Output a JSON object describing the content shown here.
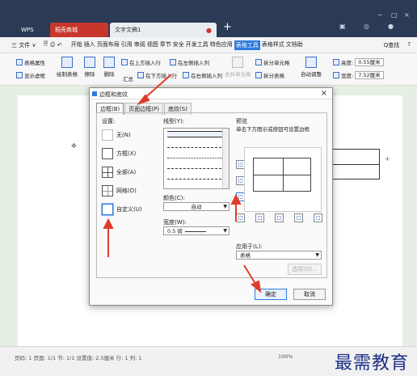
{
  "titlebar": {
    "tabs": [
      {
        "label": "WPS"
      },
      {
        "label": "稻壳商城"
      },
      {
        "label": "文字文稿1"
      }
    ],
    "new_tab": "+"
  },
  "menubar": {
    "file": "三 文件 ∨",
    "items": [
      "开始",
      "插入",
      "页面布局",
      "引用",
      "审阅",
      "视图",
      "章节",
      "安全",
      "开发工具",
      "特色应用",
      "表格工具",
      "表格样式",
      "文档助"
    ],
    "active": "表格工具",
    "search": "Q查找",
    "help": "?"
  },
  "toolbar": {
    "table_props": "表格属性",
    "show_gridlines": "显示虚框",
    "draw_table": "绘制表格",
    "erase": "擦除",
    "delete": "删除",
    "summary": "汇总",
    "insert_above": "在上方插入行",
    "insert_left": "在左侧插入列",
    "insert_below": "在下方插入行",
    "insert_right": "在右侧插入列",
    "merge_cells": "合并单元格",
    "split_cells": "拆分单元格",
    "split_table": "拆分表格",
    "autofit": "自动调整",
    "height_label": "高度:",
    "height_value": "0.55厘米",
    "width_label": "宽度:",
    "width_value": "7.52厘米"
  },
  "dialog": {
    "title": "边框和底纹",
    "close": "×",
    "tabs": [
      "边框(B)",
      "页面边框(P)",
      "底纹(S)"
    ],
    "active_tab": "边框(B)",
    "setting_label": "设置:",
    "settings": [
      "无(N)",
      "方框(X)",
      "全部(A)",
      "网格(D)",
      "自定义(U)"
    ],
    "selected_setting": "自定义(U)",
    "style_label": "线型(Y):",
    "color_label": "颜色(C):",
    "color_value": "自动",
    "width_label": "宽度(W):",
    "width_value": "0.5  磅",
    "preview_label": "预览",
    "preview_hint": "单击下方图示或按钮可设置边框",
    "apply_label": "应用于(L):",
    "apply_value": "表格",
    "options_button": "选项(O)...",
    "ok": "确定",
    "cancel": "取消"
  },
  "statusbar": {
    "text": "页码: 1  页面: 1/1  节: 1/1  设置值: 2.5厘米  行: 1  列: 1",
    "zoom": "100%",
    "watermark": "最需教育"
  },
  "colors": {
    "accent": "#2f7be0",
    "arrow": "#e03c2c",
    "titlebar": "#2b3a55"
  }
}
